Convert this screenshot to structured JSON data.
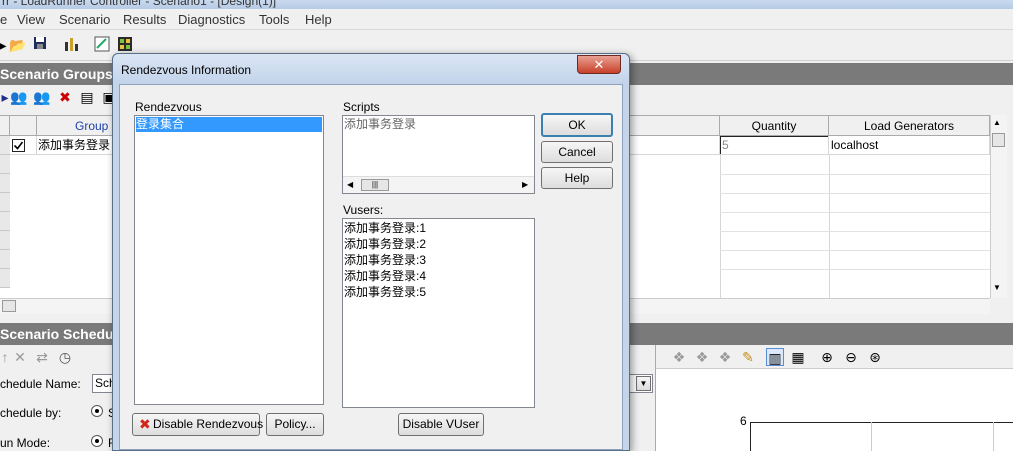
{
  "app": {
    "title_fragment": "rr - LoadRunner Controller - Scenario1 - [Design(1)]"
  },
  "menu": [
    "e",
    "View",
    "Scenario",
    "Results",
    "Diagnostics",
    "Tools",
    "Help"
  ],
  "groups_panel": {
    "title": "Scenario Groups",
    "columns": {
      "group_name": "Group N",
      "quantity": "Quantity",
      "load_generators": "Load Generators"
    },
    "rows": [
      {
        "name": "添加事务登录",
        "quantity": "5",
        "load_generator": "localhost",
        "checked": true
      }
    ]
  },
  "schedule_panel": {
    "title": "Scenario Schedu",
    "schedule_name_label": "chedule Name:",
    "schedule_name_value": "Sch",
    "schedule_by_label": "chedule by:",
    "schedule_by_option": "S",
    "run_mode_label": "un Mode:",
    "run_mode_option": "R",
    "graph_y_tick": "6"
  },
  "dialog": {
    "title": "Rendezvous Information",
    "close_glyph": "✕",
    "rendezvous_label": "Rendezvous",
    "rendezvous_items": [
      "登录集合"
    ],
    "scripts_label": "Scripts",
    "scripts_items": [
      "添加事务登录"
    ],
    "vusers_label": "Vusers:",
    "vusers_items": [
      "添加事务登录:1",
      "添加事务登录:2",
      "添加事务登录:3",
      "添加事务登录:4",
      "添加事务登录:5"
    ],
    "ok_label": "OK",
    "cancel_label": "Cancel",
    "help_label": "Help",
    "disable_rendezvous_label": "Disable Rendezvous",
    "policy_label": "Policy...",
    "disable_vuser_label": "Disable VUser"
  },
  "colors": {
    "selection": "#3399ff",
    "panel_header": "#7a7a7a",
    "dialog_frame": "#c5d5e9"
  }
}
